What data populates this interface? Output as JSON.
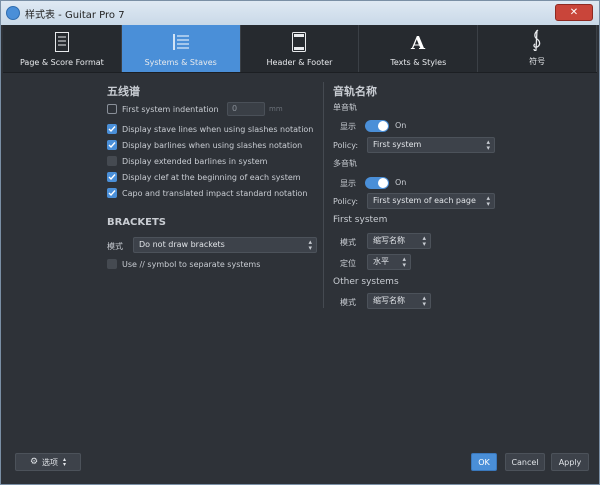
{
  "window": {
    "title": "样式表 - Guitar Pro 7",
    "close_glyph": "✕"
  },
  "tabs": [
    {
      "label": "Page & Score Format",
      "icon": "page-icon",
      "active": false
    },
    {
      "label": "Systems & Staves",
      "icon": "staves-icon",
      "active": true
    },
    {
      "label": "Header & Footer",
      "icon": "header-footer-icon",
      "active": false
    },
    {
      "label": "Texts & Styles",
      "icon": "text-icon",
      "active": false
    },
    {
      "label": "符号",
      "icon": "treble-clef-icon",
      "active": false
    }
  ],
  "left": {
    "title": "五线谱",
    "first_indent": {
      "label": "First system indentation",
      "value": "0",
      "unit": "mm",
      "checked": false
    },
    "options": [
      {
        "label": "Display stave lines when using slashes notation",
        "checked": true
      },
      {
        "label": "Display barlines when using slashes notation",
        "checked": true
      },
      {
        "label": "Display extended barlines in system",
        "checked": false
      },
      {
        "label": "Display clef at the beginning of each system",
        "checked": true
      },
      {
        "label": "Capo and translated impact standard notation",
        "checked": true
      }
    ],
    "brackets": {
      "title": "BRACKETS",
      "mode_label": "模式",
      "mode_value": "Do not draw brackets",
      "symbol_option": {
        "label": "Use // symbol to separate systems",
        "checked": false
      }
    }
  },
  "right": {
    "title": "音轨名称",
    "single_track": {
      "label": "单音轨",
      "show_label": "显示",
      "toggle_text": "On",
      "policy_label": "Policy:",
      "policy_value": "First system"
    },
    "multi_track": {
      "label": "多音轨",
      "show_label": "显示",
      "toggle_text": "On",
      "policy_label": "Policy:",
      "policy_value": "First system of each page"
    },
    "first_system": {
      "title": "First system",
      "mode_label": "模式",
      "mode_value": "缩写名称",
      "position_label": "定位",
      "position_value": "水平"
    },
    "other_systems": {
      "title": "Other systems",
      "mode_label": "模式",
      "mode_value": "缩写名称"
    }
  },
  "footer": {
    "options_label": "选项",
    "ok": "OK",
    "cancel": "Cancel",
    "apply": "Apply"
  },
  "colors": {
    "accent": "#4a8fd8",
    "background": "#2e3238"
  }
}
